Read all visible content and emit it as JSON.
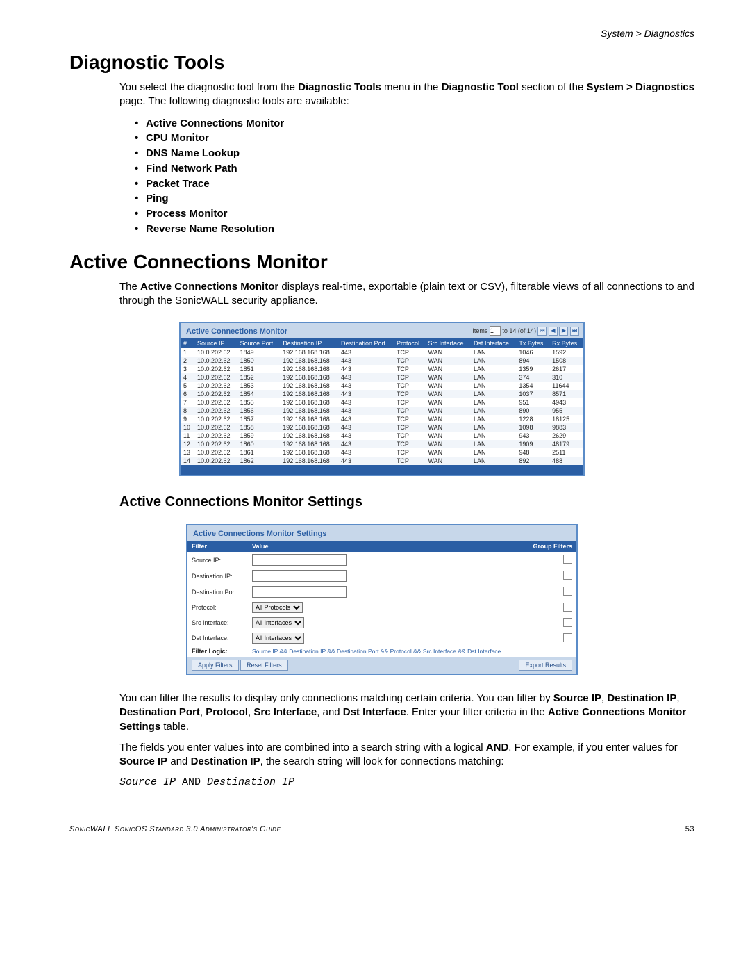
{
  "breadcrumb": "System > Diagnostics",
  "h1_tools": "Diagnostic Tools",
  "intro": {
    "p1_pre": "You select the diagnostic tool from the ",
    "p1_b1": "Diagnostic Tools",
    "p1_mid1": " menu in the ",
    "p1_b2": "Diagnostic Tool",
    "p1_mid2": " section of the ",
    "p1_b3": "System > Diagnostics",
    "p1_post": " page. The following diagnostic tools are available:"
  },
  "tool_list": [
    "Active Connections Monitor",
    "CPU Monitor",
    "DNS Name Lookup",
    "Find Network Path",
    "Packet Trace",
    "Ping",
    "Process Monitor",
    "Reverse Name Resolution"
  ],
  "h1_acm": "Active Connections Monitor",
  "acm_para": {
    "pre": "The ",
    "b": "Active Connections Monitor",
    "post": " displays real-time, exportable (plain text or CSV), filterable views of all connections to and through the SonicWALL security appliance."
  },
  "monitor_panel": {
    "title": "Active Connections Monitor",
    "items_label": "Items",
    "items_value": "1",
    "range": "to 14 (of 14)",
    "columns": [
      "#",
      "Source IP",
      "Source Port",
      "Destination IP",
      "Destination Port",
      "Protocol",
      "Src Interface",
      "Dst Interface",
      "Tx Bytes",
      "Rx Bytes"
    ],
    "rows": [
      [
        "1",
        "10.0.202.62",
        "1849",
        "192.168.168.168",
        "443",
        "TCP",
        "WAN",
        "LAN",
        "1046",
        "1592"
      ],
      [
        "2",
        "10.0.202.62",
        "1850",
        "192.168.168.168",
        "443",
        "TCP",
        "WAN",
        "LAN",
        "894",
        "1508"
      ],
      [
        "3",
        "10.0.202.62",
        "1851",
        "192.168.168.168",
        "443",
        "TCP",
        "WAN",
        "LAN",
        "1359",
        "2617"
      ],
      [
        "4",
        "10.0.202.62",
        "1852",
        "192.168.168.168",
        "443",
        "TCP",
        "WAN",
        "LAN",
        "374",
        "310"
      ],
      [
        "5",
        "10.0.202.62",
        "1853",
        "192.168.168.168",
        "443",
        "TCP",
        "WAN",
        "LAN",
        "1354",
        "11644"
      ],
      [
        "6",
        "10.0.202.62",
        "1854",
        "192.168.168.168",
        "443",
        "TCP",
        "WAN",
        "LAN",
        "1037",
        "8571"
      ],
      [
        "7",
        "10.0.202.62",
        "1855",
        "192.168.168.168",
        "443",
        "TCP",
        "WAN",
        "LAN",
        "951",
        "4943"
      ],
      [
        "8",
        "10.0.202.62",
        "1856",
        "192.168.168.168",
        "443",
        "TCP",
        "WAN",
        "LAN",
        "890",
        "955"
      ],
      [
        "9",
        "10.0.202.62",
        "1857",
        "192.168.168.168",
        "443",
        "TCP",
        "WAN",
        "LAN",
        "1228",
        "18125"
      ],
      [
        "10",
        "10.0.202.62",
        "1858",
        "192.168.168.168",
        "443",
        "TCP",
        "WAN",
        "LAN",
        "1098",
        "9883"
      ],
      [
        "11",
        "10.0.202.62",
        "1859",
        "192.168.168.168",
        "443",
        "TCP",
        "WAN",
        "LAN",
        "943",
        "2629"
      ],
      [
        "12",
        "10.0.202.62",
        "1860",
        "192.168.168.168",
        "443",
        "TCP",
        "WAN",
        "LAN",
        "1909",
        "48179"
      ],
      [
        "13",
        "10.0.202.62",
        "1861",
        "192.168.168.168",
        "443",
        "TCP",
        "WAN",
        "LAN",
        "948",
        "2511"
      ],
      [
        "14",
        "10.0.202.62",
        "1862",
        "192.168.168.168",
        "443",
        "TCP",
        "WAN",
        "LAN",
        "892",
        "488"
      ]
    ]
  },
  "h2_settings": "Active Connections Monitor Settings",
  "settings_panel": {
    "title": "Active Connections Monitor Settings",
    "col_filter": "Filter",
    "col_value": "Value",
    "col_group": "Group Filters",
    "rows": [
      {
        "label": "Source IP:",
        "type": "text"
      },
      {
        "label": "Destination IP:",
        "type": "text"
      },
      {
        "label": "Destination Port:",
        "type": "text"
      },
      {
        "label": "Protocol:",
        "type": "select",
        "value": "All Protocols"
      },
      {
        "label": "Src Interface:",
        "type": "select",
        "value": "All Interfaces"
      },
      {
        "label": "Dst Interface:",
        "type": "select",
        "value": "All Interfaces"
      }
    ],
    "filter_logic_label": "Filter Logic:",
    "filter_logic_value": "Source IP && Destination IP && Destination Port && Protocol && Src Interface && Dst Interface",
    "btn_apply": "Apply Filters",
    "btn_reset": "Reset Filters",
    "btn_export": "Export Results"
  },
  "filter_para": {
    "p1_a": "You can filter the results to display only connections matching certain criteria. You can filter by ",
    "b_src": "Source IP",
    "sep": ", ",
    "b_dip": "Destination IP",
    "b_dport": "Destination Port",
    "b_proto": "Protocol",
    "b_srci": "Src Interface",
    "and": ", and ",
    "b_dsti": "Dst Interface",
    "p1_b": ". Enter your filter criteria in the ",
    "b_tbl": "Active Connections Monitor Settings",
    "p1_c": " table."
  },
  "and_para": {
    "a": "The fields you enter values into are combined into a search string with a logical ",
    "b_and": "AND",
    "b": ". For example, if you enter values for ",
    "b_src": "Source IP",
    "mid": " and ",
    "b_dst": "Destination IP",
    "c": ", the search string will look for connections matching:"
  },
  "code_line": {
    "i1": "Source IP",
    "mid": " AND ",
    "i2": "Destination IP"
  },
  "footer": {
    "text": "SonicWALL SonicOS Standard 3.0 Administrator's Guide",
    "page": "53"
  }
}
